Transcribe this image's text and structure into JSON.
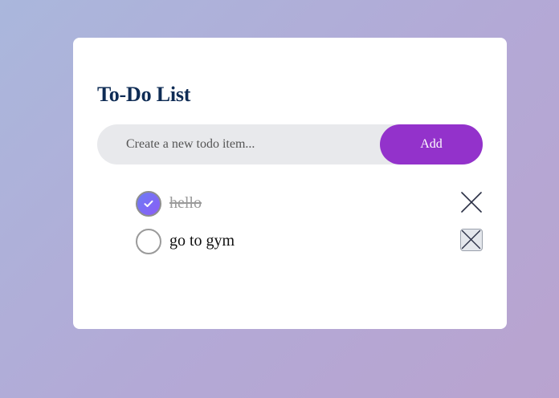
{
  "app": {
    "title": "To-Do List"
  },
  "new_todo": {
    "value": "",
    "placeholder": "Create a new todo item...",
    "add_label": "Add"
  },
  "todos": [
    {
      "text": "hello",
      "completed": true
    },
    {
      "text": "go to gym",
      "completed": false
    }
  ],
  "colors": {
    "title": "#0f2c55",
    "add_button": "#9332cb",
    "checked_start": "#6d7cf4",
    "checked_end": "#8b5cf6",
    "completed_text": "#9a9a9a"
  },
  "icons": {
    "check": "check-icon",
    "delete": "close-icon"
  }
}
